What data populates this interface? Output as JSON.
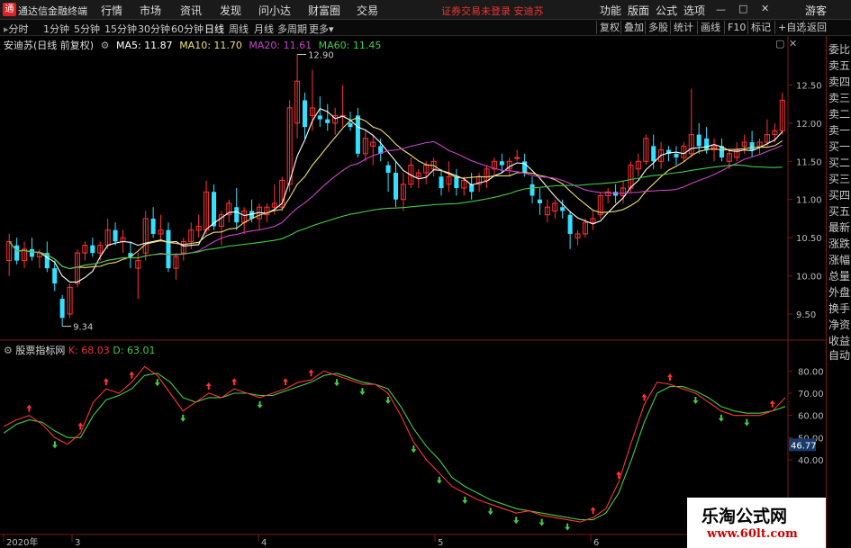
{
  "titlebar": {
    "app_title": "通达信金融终端",
    "menus": [
      "行情",
      "市场",
      "资讯",
      "发现",
      "问小达",
      "财富圈",
      "交易"
    ],
    "login_note": "证券交易未登录  安迪苏",
    "right_menus": [
      "功能",
      "版面",
      "公式",
      "选项"
    ],
    "guest": "游客"
  },
  "toolbar": {
    "timeframes": [
      "分时",
      "1分钟",
      "5分钟",
      "15分钟",
      "30分钟",
      "60分钟",
      "日线",
      "周线",
      "月线",
      "多周期",
      "更多"
    ],
    "active_timeframe": "日线",
    "right_buttons": [
      "复权",
      "叠加",
      "多股",
      "统计",
      "画线",
      "F10",
      "标记",
      "+自选",
      "返回"
    ]
  },
  "legend": {
    "stock": "安迪苏(日线 前复权)",
    "ma5": "MA5: 11.87",
    "ma10": "MA10: 11.70",
    "ma20": "MA20: 11.61",
    "ma60": "MA60: 11.45",
    "colors": {
      "ma5": "#ffffff",
      "ma10": "#f0e070",
      "ma20": "#cc44cc",
      "ma60": "#44cc44"
    }
  },
  "price_axis": [
    "12.50",
    "12.00",
    "11.50",
    "11.00",
    "10.50",
    "10.00",
    "9.50"
  ],
  "annotations": {
    "high": "12.90",
    "low": "9.34"
  },
  "sidepanel": [
    "委比",
    "卖五",
    "卖四",
    "卖三",
    "卖二",
    "卖一",
    "买一",
    "买二",
    "买三",
    "买四",
    "买五",
    "最新",
    "涨跌",
    "涨幅",
    "总量",
    "外盘",
    "换手",
    "净资",
    "收益",
    "自动"
  ],
  "indicator": {
    "name": "股票指标网",
    "k": "K: 68.03",
    "d": "D: 63.01",
    "axis": [
      "80.00",
      "70.00",
      "60.00",
      "50.00",
      "40.00"
    ],
    "current": "46.77"
  },
  "date_axis": [
    "2020年",
    "3",
    "4",
    "5",
    "6"
  ],
  "watermark": {
    "title": "乐淘公式网",
    "url": "www.60lt.com"
  },
  "chart_data": {
    "type": "candlestick",
    "ylim": [
      9.3,
      13.0
    ],
    "candles": [
      [
        10.2,
        10.55,
        10.0,
        10.45
      ],
      [
        10.4,
        10.5,
        10.15,
        10.2
      ],
      [
        10.2,
        10.45,
        10.1,
        10.35
      ],
      [
        10.35,
        10.5,
        10.2,
        10.25
      ],
      [
        10.25,
        10.35,
        10.1,
        10.3
      ],
      [
        10.3,
        10.45,
        10.05,
        10.1
      ],
      [
        10.1,
        10.2,
        9.8,
        9.9
      ],
      [
        9.7,
        9.75,
        9.34,
        9.45
      ],
      [
        9.5,
        9.9,
        9.45,
        9.85
      ],
      [
        9.9,
        10.35,
        9.85,
        10.3
      ],
      [
        10.3,
        10.45,
        10.2,
        10.4
      ],
      [
        10.4,
        10.5,
        10.25,
        10.3
      ],
      [
        10.3,
        10.45,
        10.2,
        10.4
      ],
      [
        10.4,
        10.75,
        10.35,
        10.6
      ],
      [
        10.6,
        10.7,
        10.4,
        10.45
      ],
      [
        10.45,
        10.6,
        10.3,
        10.5
      ],
      [
        10.3,
        10.45,
        10.1,
        10.25
      ],
      [
        10.1,
        10.3,
        9.7,
        10.2
      ],
      [
        10.3,
        10.85,
        10.2,
        10.75
      ],
      [
        10.75,
        10.9,
        10.5,
        10.55
      ],
      [
        10.55,
        10.8,
        10.45,
        10.6
      ],
      [
        10.6,
        10.7,
        10.05,
        10.1
      ],
      [
        10.1,
        10.3,
        9.95,
        10.25
      ],
      [
        10.3,
        10.5,
        10.2,
        10.45
      ],
      [
        10.45,
        10.7,
        10.35,
        10.6
      ],
      [
        10.6,
        10.8,
        10.5,
        10.65
      ],
      [
        10.6,
        11.25,
        10.55,
        11.1
      ],
      [
        11.1,
        11.2,
        10.6,
        10.65
      ],
      [
        10.65,
        10.85,
        10.4,
        10.8
      ],
      [
        10.8,
        11.0,
        10.7,
        10.95
      ],
      [
        10.9,
        11.15,
        10.6,
        10.7
      ],
      [
        10.7,
        10.9,
        10.55,
        10.85
      ],
      [
        10.85,
        11.0,
        10.7,
        10.75
      ],
      [
        10.75,
        10.95,
        10.6,
        10.9
      ],
      [
        10.8,
        10.95,
        10.7,
        10.9
      ],
      [
        10.9,
        11.2,
        10.8,
        10.95
      ],
      [
        10.9,
        11.3,
        10.85,
        11.25
      ],
      [
        11.2,
        12.3,
        11.1,
        12.2
      ],
      [
        12.0,
        12.9,
        11.8,
        12.55
      ],
      [
        12.3,
        12.4,
        11.8,
        11.95
      ],
      [
        12.1,
        12.7,
        11.9,
        12.2
      ],
      [
        12.1,
        12.35,
        11.95,
        12.05
      ],
      [
        12.05,
        12.25,
        11.9,
        12.0
      ],
      [
        12.0,
        12.2,
        11.85,
        12.1
      ],
      [
        12.1,
        12.5,
        11.95,
        12.1
      ],
      [
        12.0,
        12.15,
        11.9,
        11.95
      ],
      [
        12.1,
        12.2,
        11.55,
        11.6
      ],
      [
        11.6,
        11.9,
        11.5,
        11.8
      ],
      [
        11.7,
        11.85,
        11.45,
        11.75
      ],
      [
        11.7,
        11.8,
        11.5,
        11.6
      ],
      [
        11.45,
        11.5,
        11.1,
        11.35
      ],
      [
        11.35,
        11.5,
        10.9,
        11.0
      ],
      [
        11.0,
        11.35,
        10.85,
        11.2
      ],
      [
        11.2,
        11.55,
        11.15,
        11.45
      ],
      [
        11.3,
        11.4,
        11.15,
        11.35
      ],
      [
        11.35,
        11.5,
        11.2,
        11.45
      ],
      [
        11.4,
        11.55,
        11.3,
        11.5
      ],
      [
        11.3,
        11.4,
        11.05,
        11.15
      ],
      [
        11.2,
        11.5,
        11.1,
        11.3
      ],
      [
        11.3,
        11.4,
        11.05,
        11.15
      ],
      [
        11.15,
        11.3,
        11.05,
        11.25
      ],
      [
        11.2,
        11.35,
        11.0,
        11.1
      ],
      [
        11.2,
        11.35,
        11.1,
        11.3
      ],
      [
        11.25,
        11.45,
        11.15,
        11.4
      ],
      [
        11.4,
        11.55,
        11.3,
        11.5
      ],
      [
        11.5,
        11.6,
        11.35,
        11.45
      ],
      [
        11.4,
        11.55,
        11.3,
        11.5
      ],
      [
        11.55,
        11.65,
        11.5,
        11.55
      ],
      [
        11.5,
        11.6,
        11.3,
        11.35
      ],
      [
        11.2,
        11.3,
        10.95,
        11.05
      ],
      [
        11.0,
        11.15,
        10.8,
        10.95
      ],
      [
        10.8,
        11.0,
        10.7,
        10.9
      ],
      [
        10.85,
        11.0,
        10.75,
        10.95
      ],
      [
        10.9,
        11.0,
        10.75,
        10.85
      ],
      [
        10.8,
        10.85,
        10.35,
        10.55
      ],
      [
        10.5,
        10.6,
        10.4,
        10.55
      ],
      [
        10.55,
        10.75,
        10.5,
        10.7
      ],
      [
        10.7,
        10.85,
        10.6,
        10.75
      ],
      [
        10.8,
        11.1,
        10.75,
        11.05
      ],
      [
        11.05,
        11.15,
        10.95,
        11.1
      ],
      [
        11.1,
        11.2,
        10.95,
        11.05
      ],
      [
        11.05,
        11.25,
        10.95,
        11.15
      ],
      [
        11.15,
        11.5,
        11.1,
        11.45
      ],
      [
        11.4,
        11.6,
        11.3,
        11.5
      ],
      [
        11.5,
        11.85,
        11.45,
        11.8
      ],
      [
        11.7,
        11.85,
        11.4,
        11.5
      ],
      [
        11.5,
        11.75,
        11.4,
        11.65
      ],
      [
        11.65,
        11.7,
        11.5,
        11.6
      ],
      [
        11.6,
        11.7,
        11.45,
        11.55
      ],
      [
        11.55,
        11.75,
        11.5,
        11.7
      ],
      [
        11.6,
        12.45,
        11.55,
        11.85
      ],
      [
        11.85,
        12.0,
        11.6,
        11.7
      ],
      [
        11.8,
        11.95,
        11.6,
        11.65
      ],
      [
        11.65,
        11.8,
        11.5,
        11.7
      ],
      [
        11.7,
        11.8,
        11.5,
        11.55
      ],
      [
        11.5,
        11.65,
        11.4,
        11.6
      ],
      [
        11.55,
        11.75,
        11.5,
        11.65
      ],
      [
        11.7,
        11.85,
        11.6,
        11.75
      ],
      [
        11.75,
        11.9,
        11.55,
        11.65
      ],
      [
        11.7,
        11.8,
        11.6,
        11.75
      ],
      [
        11.75,
        12.05,
        11.7,
        11.85
      ],
      [
        11.85,
        12.0,
        11.75,
        11.9
      ],
      [
        11.9,
        12.4,
        11.85,
        12.3
      ]
    ],
    "kdj_k": [
      55,
      58,
      60,
      56,
      50,
      47,
      52,
      66,
      72,
      70,
      75,
      82,
      78,
      70,
      62,
      66,
      70,
      68,
      72,
      70,
      68,
      70,
      72,
      75,
      76,
      80,
      78,
      76,
      74,
      74,
      70,
      60,
      48,
      40,
      34,
      28,
      25,
      22,
      20,
      18,
      16,
      17,
      15,
      14,
      13,
      12,
      14,
      18,
      30,
      48,
      65,
      75,
      74,
      72,
      70,
      66,
      62,
      60,
      60,
      60,
      62,
      68
    ],
    "kdj_d": [
      52,
      56,
      58,
      57,
      53,
      50,
      50,
      60,
      67,
      69,
      72,
      78,
      79,
      75,
      68,
      66,
      68,
      68,
      70,
      70,
      69,
      69,
      71,
      73,
      75,
      78,
      79,
      77,
      75,
      74,
      72,
      64,
      54,
      46,
      40,
      32,
      28,
      25,
      22,
      20,
      18,
      17,
      16,
      15,
      14,
      13,
      13,
      16,
      25,
      40,
      57,
      70,
      73,
      73,
      71,
      68,
      64,
      62,
      61,
      61,
      62,
      64
    ]
  }
}
